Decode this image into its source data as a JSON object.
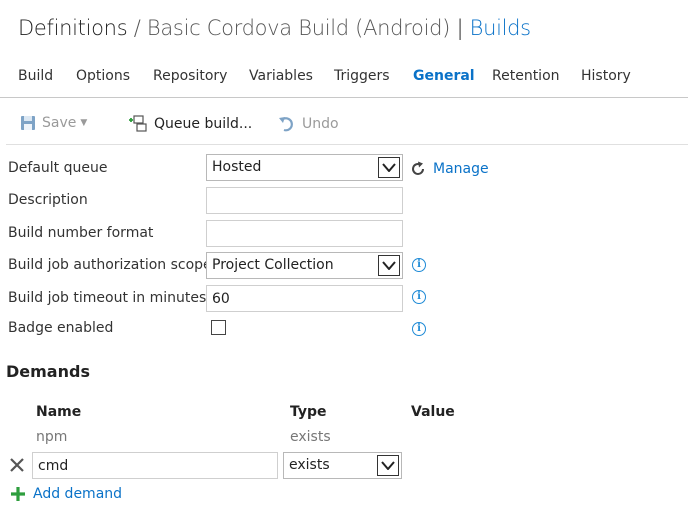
{
  "header": {
    "definitions": "Definitions",
    "sep1": "/",
    "definition_name": "Basic Cordova Build (Android)",
    "sep2": "|",
    "builds_link": "Builds"
  },
  "tabs": [
    {
      "label": "Build"
    },
    {
      "label": "Options"
    },
    {
      "label": "Repository"
    },
    {
      "label": "Variables"
    },
    {
      "label": "Triggers"
    },
    {
      "label": "General",
      "active": true
    },
    {
      "label": "Retention"
    },
    {
      "label": "History"
    }
  ],
  "toolbar": {
    "save_label": "Save",
    "queue_label": "Queue build...",
    "undo_label": "Undo"
  },
  "form": {
    "default_queue": {
      "label": "Default queue",
      "value": "Hosted",
      "manage_label": "Manage"
    },
    "description": {
      "label": "Description",
      "value": ""
    },
    "build_number_format": {
      "label": "Build number format",
      "value": ""
    },
    "auth_scope": {
      "label": "Build job authorization scope",
      "value": "Project Collection"
    },
    "timeout": {
      "label": "Build job timeout in minutes",
      "value": "60"
    },
    "badge": {
      "label": "Badge enabled",
      "checked": false
    }
  },
  "demands": {
    "title": "Demands",
    "columns": {
      "name": "Name",
      "type": "Type",
      "value": "Value"
    },
    "rows": [
      {
        "name": "npm",
        "type": "exists",
        "editable": false
      },
      {
        "name": "cmd",
        "type": "exists",
        "editable": true
      }
    ],
    "add_label": "Add demand"
  },
  "colors": {
    "accent": "#0a72c8",
    "info": "#1e8ad6",
    "add_green": "#2e9e3e"
  }
}
